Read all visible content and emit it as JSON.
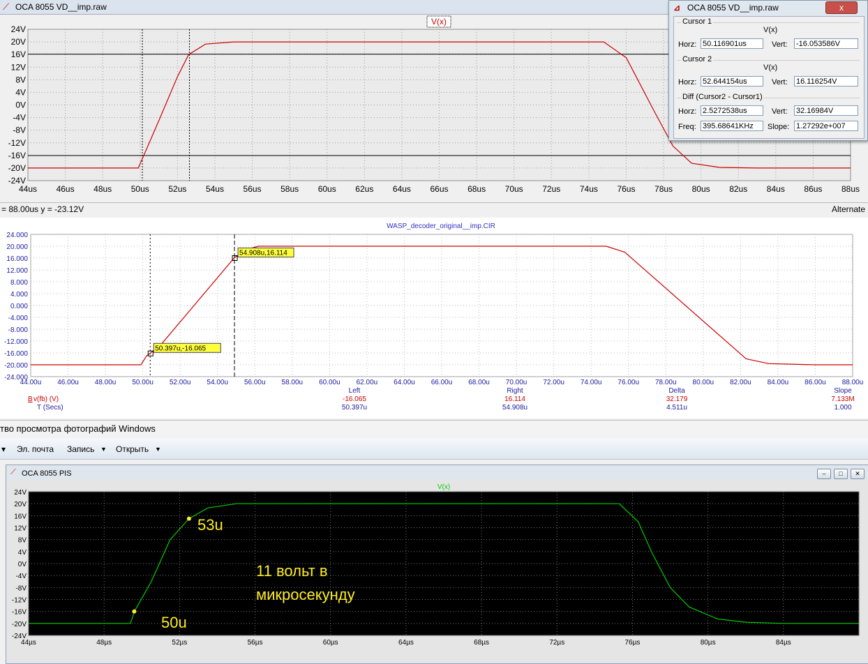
{
  "window1": {
    "title": "OCA 8055 VD__imp.raw"
  },
  "plot1": {
    "trace": "V(x)",
    "xticks": [
      "44us",
      "46us",
      "48us",
      "50us",
      "52us",
      "54us",
      "56us",
      "58us",
      "60us",
      "62us",
      "64us",
      "66us",
      "68us",
      "70us",
      "72us",
      "74us",
      "76us",
      "78us",
      "80us",
      "82us",
      "84us",
      "86us",
      "88us"
    ],
    "yticks": [
      "24V",
      "20V",
      "16V",
      "12V",
      "8V",
      "4V",
      "0V",
      "-4V",
      "-8V",
      "-12V",
      "-16V",
      "-20V",
      "-24V"
    ],
    "status_left": "= 88.00us   y = -23.12V",
    "status_right": "Alternate",
    "color": "#cc0000"
  },
  "cursor_window": {
    "title": "OCA 8055 VD__imp.raw",
    "close": "x",
    "cursor1": {
      "label": "Cursor 1",
      "trace": "V(x)",
      "horz_label": "Horz:",
      "horz": "50.116901us",
      "vert_label": "Vert:",
      "vert": "-16.053586V"
    },
    "cursor2": {
      "label": "Cursor 2",
      "trace": "V(x)",
      "horz_label": "Horz:",
      "horz": "52.644154us",
      "vert_label": "Vert:",
      "vert": "16.116254V"
    },
    "diff": {
      "label": "Diff (Cursor2 - Cursor1)",
      "horz_label": "Horz:",
      "horz": "2.5272538us",
      "vert_label": "Vert:",
      "vert": "32.16984V",
      "freq_label": "Freq:",
      "freq": "395.68641KHz",
      "slope_label": "Slope:",
      "slope": "1.27292e+007"
    }
  },
  "plot2": {
    "title": "WASP_decoder_original__imp.CIR",
    "xticks": [
      "44.00u",
      "46.00u",
      "48.00u",
      "50.00u",
      "52.00u",
      "54.00u",
      "56.00u",
      "58.00u",
      "60.00u",
      "62.00u",
      "64.00u",
      "66.00u",
      "68.00u",
      "70.00u",
      "72.00u",
      "74.00u",
      "76.00u",
      "78.00u",
      "80.00u",
      "82.00u",
      "84.00u",
      "86.00u",
      "88.00u"
    ],
    "yticks": [
      "24.000",
      "20.000",
      "16.000",
      "12.000",
      "8.000",
      "4.000",
      "0.000",
      "-4.000",
      "-8.000",
      "-12.000",
      "-16.000",
      "-20.000",
      "-24.000"
    ],
    "marker1": "50.397u,-16.065",
    "marker2": "54.908u,16.114",
    "table": {
      "headers": [
        "Left",
        "Right",
        "Delta",
        "Slope"
      ],
      "row1_label": "v(fb) (V)",
      "row1_prefix": "B",
      "row1": [
        "-16.065",
        "16.114",
        "32.179",
        "7.133M"
      ],
      "row2_label": "T (Secs)",
      "row2": [
        "50.397u",
        "54.908u",
        "4.511u",
        "1.000"
      ]
    },
    "color": "#cc0000"
  },
  "photo_viewer": {
    "title": "тво просмотра фотографий Windows",
    "toolbar": [
      "Эл. почта",
      "Запись",
      "Открыть"
    ]
  },
  "window3": {
    "title": "OCA 8055 PIS",
    "trace": "V(x)",
    "xticks": [
      "44µs",
      "48µs",
      "52µs",
      "56µs",
      "60µs",
      "64µs",
      "68µs",
      "72µs",
      "76µs",
      "80µs",
      "84µs"
    ],
    "yticks": [
      "24V",
      "20V",
      "16V",
      "12V",
      "8V",
      "4V",
      "0V",
      "-4V",
      "-8V",
      "-12V",
      "-16V",
      "-20V",
      "-24V"
    ],
    "ann_53": "53u",
    "ann_50": "50u",
    "ann_text1": "11 вольт в",
    "ann_text2": "микросекунду",
    "color": "#00cc00",
    "ann_color": "#ffee22"
  },
  "chart_data": [
    {
      "type": "line",
      "series": [
        {
          "name": "V(x)",
          "x": [
            44,
            49.9,
            50.2,
            51,
            52,
            52.6,
            53.5,
            55,
            74.8,
            76,
            77.5,
            78.5,
            79.5,
            81,
            83,
            88
          ],
          "y": [
            -20,
            -20,
            -16,
            -5,
            9,
            16,
            19.3,
            20,
            20,
            15,
            -2,
            -13,
            -18.5,
            -19.8,
            -20,
            -20
          ]
        }
      ],
      "xlim": [
        44,
        88
      ],
      "ylim": [
        -24,
        24
      ]
    },
    {
      "type": "line",
      "series": [
        {
          "name": "v(fb) (V)",
          "x": [
            44,
            49.9,
            50.2,
            50.4,
            51,
            54.9,
            55.6,
            56.2,
            74.8,
            75.8,
            82.3,
            83.5,
            86,
            88
          ],
          "y": [
            -20,
            -20,
            -17,
            -16.1,
            -13,
            16.1,
            19,
            20,
            20,
            18,
            -18,
            -19.6,
            -20,
            -20
          ]
        }
      ],
      "xlim": [
        44,
        88
      ],
      "ylim": [
        -24,
        24
      ]
    },
    {
      "type": "line",
      "series": [
        {
          "name": "V(x)",
          "x": [
            44,
            49.4,
            49.6,
            50.5,
            51.5,
            52.5,
            53.5,
            55,
            75.3,
            76.3,
            77,
            78,
            79,
            80.5,
            82,
            84,
            88
          ],
          "y": [
            -20,
            -20,
            -16,
            -6,
            8,
            15,
            18.6,
            20,
            20,
            14,
            4,
            -8,
            -14.5,
            -18.5,
            -19.6,
            -20,
            -20
          ]
        }
      ],
      "xlim": [
        44,
        88
      ],
      "ylim": [
        -24,
        24
      ]
    }
  ]
}
